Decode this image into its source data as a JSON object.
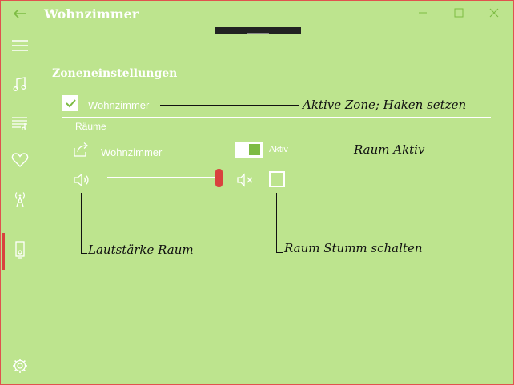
{
  "window": {
    "title": "Wohnzimmer"
  },
  "sidebar": {
    "items": [
      {
        "icon": "hamburger-icon"
      },
      {
        "icon": "music-note-icon"
      },
      {
        "icon": "playlist-icon"
      },
      {
        "icon": "heart-icon"
      },
      {
        "icon": "radio-tower-icon"
      },
      {
        "icon": "speaker-icon",
        "active": true
      }
    ],
    "settings_icon": "gear-icon"
  },
  "main": {
    "section_title": "Zoneneinstellungen",
    "zone": {
      "checked": true,
      "label": "Wohnzimmer"
    },
    "rooms_header": "Räume",
    "room": {
      "name": "Wohnzimmer",
      "toggle_on": true,
      "toggle_label": "Aktiv",
      "volume": 1.0,
      "muted": false
    }
  },
  "annotations": {
    "active_zone": "Aktive Zone; Haken setzen",
    "room_active": "Raum Aktiv",
    "room_volume": "Lautstärke Raum",
    "room_mute": "Raum Stumm schalten"
  },
  "colors": {
    "background": "#bde48e",
    "accent": "#7dbb43",
    "highlight": "#d9413e"
  }
}
